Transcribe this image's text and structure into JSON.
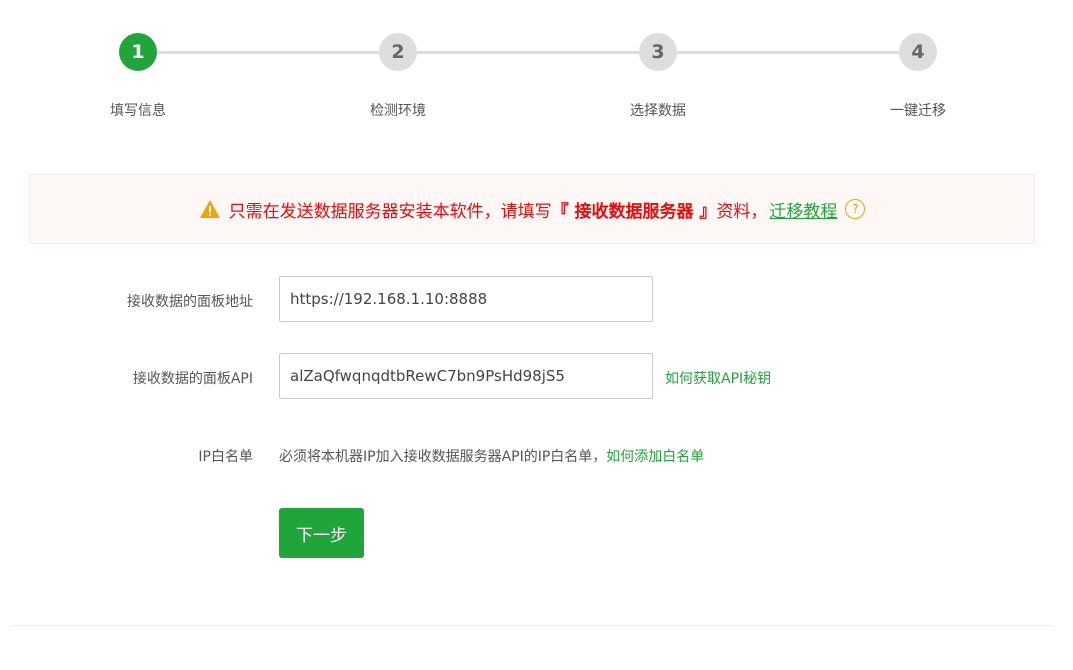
{
  "steps": [
    {
      "number": "1",
      "label": "填写信息"
    },
    {
      "number": "2",
      "label": "检测环境"
    },
    {
      "number": "3",
      "label": "选择数据"
    },
    {
      "number": "4",
      "label": "一键迁移"
    }
  ],
  "banner": {
    "text_before": "只需在发送数据服务器安装本软件，请填写",
    "highlight": "『 接收数据服务器 』",
    "text_after": "资料，",
    "tutorial_link": "迁移教程",
    "help_symbol": "?",
    "icon": "warning-triangle-icon"
  },
  "form": {
    "panel_url": {
      "label": "接收数据的面板地址",
      "value": "https://192.168.1.10:8888"
    },
    "panel_api": {
      "label": "接收数据的面板API",
      "value": "alZaQfwqnqdtbRewC7bn9PsHd98jS5",
      "help_link": "如何获取API秘钥"
    },
    "whitelist": {
      "label": "IP白名单",
      "text": "必须将本机器IP加入接收数据服务器API的IP白名单，",
      "help_link": "如何添加白名单"
    },
    "next_button": "下一步"
  },
  "colors": {
    "accent_green": "#20a53a",
    "warning_red": "#ef0808",
    "warning_icon": "#f0a500"
  }
}
